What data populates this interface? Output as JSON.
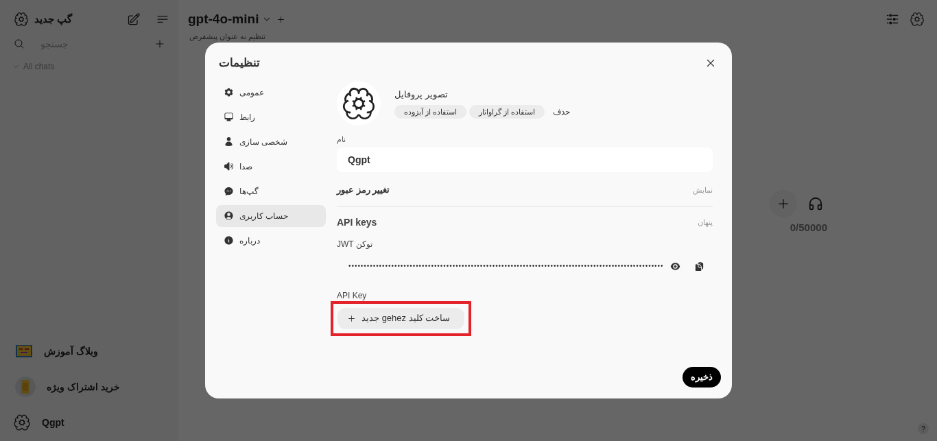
{
  "sidebar": {
    "new_chat": "گپ جدید",
    "search": {
      "placeholder": "جستجو"
    },
    "folder": {
      "label": "All chats"
    },
    "bottom_items": [
      {
        "kind": "blog",
        "label": "وبلاگ آموزش"
      },
      {
        "kind": "subscription",
        "label": "خرید اشتراک ویژه"
      }
    ],
    "user": {
      "name": "Qgpt"
    }
  },
  "header": {
    "model": "gpt-4o-mini",
    "set_default": "تنظیم به عنوان پیشفرض"
  },
  "composer": {
    "counter": "0/50000"
  },
  "help": "?",
  "settings": {
    "title": "تنظیمات",
    "tabs": [
      {
        "label": "عمومی",
        "selected": false
      },
      {
        "label": "رابط",
        "selected": false
      },
      {
        "label": "شخصی سازی",
        "selected": false
      },
      {
        "label": "صدا",
        "selected": false
      },
      {
        "label": "گپ‌ها",
        "selected": false
      },
      {
        "label": "حساب کاربری",
        "selected": true
      },
      {
        "label": "درباره",
        "selected": false
      }
    ],
    "profile": {
      "label": "تصویر پروفایل",
      "actions": [
        {
          "kind": "link",
          "label": "حذف"
        },
        {
          "kind": "chip",
          "label": "استفاده از گراواتار"
        },
        {
          "kind": "chip",
          "label": "استفاده از آبزوده"
        }
      ]
    },
    "name": {
      "label": "نام",
      "value": "Qgpt"
    },
    "password": {
      "label": "تغییر رمز عبور",
      "toggle": "نمایش"
    },
    "api": {
      "label": "API keys",
      "toggle": "پنهان",
      "jwt_label": "توکن JWT",
      "jwt_masked": "•••••••••••••••••••••••••••••••••••••••••••••••••••••••••••••••••••••••••••••••••••••••••••••••••••••••",
      "key_label": "API Key",
      "create_button": "ساخت کلید gehez جدید",
      "highlighted": true
    },
    "save": "ذخیره"
  }
}
